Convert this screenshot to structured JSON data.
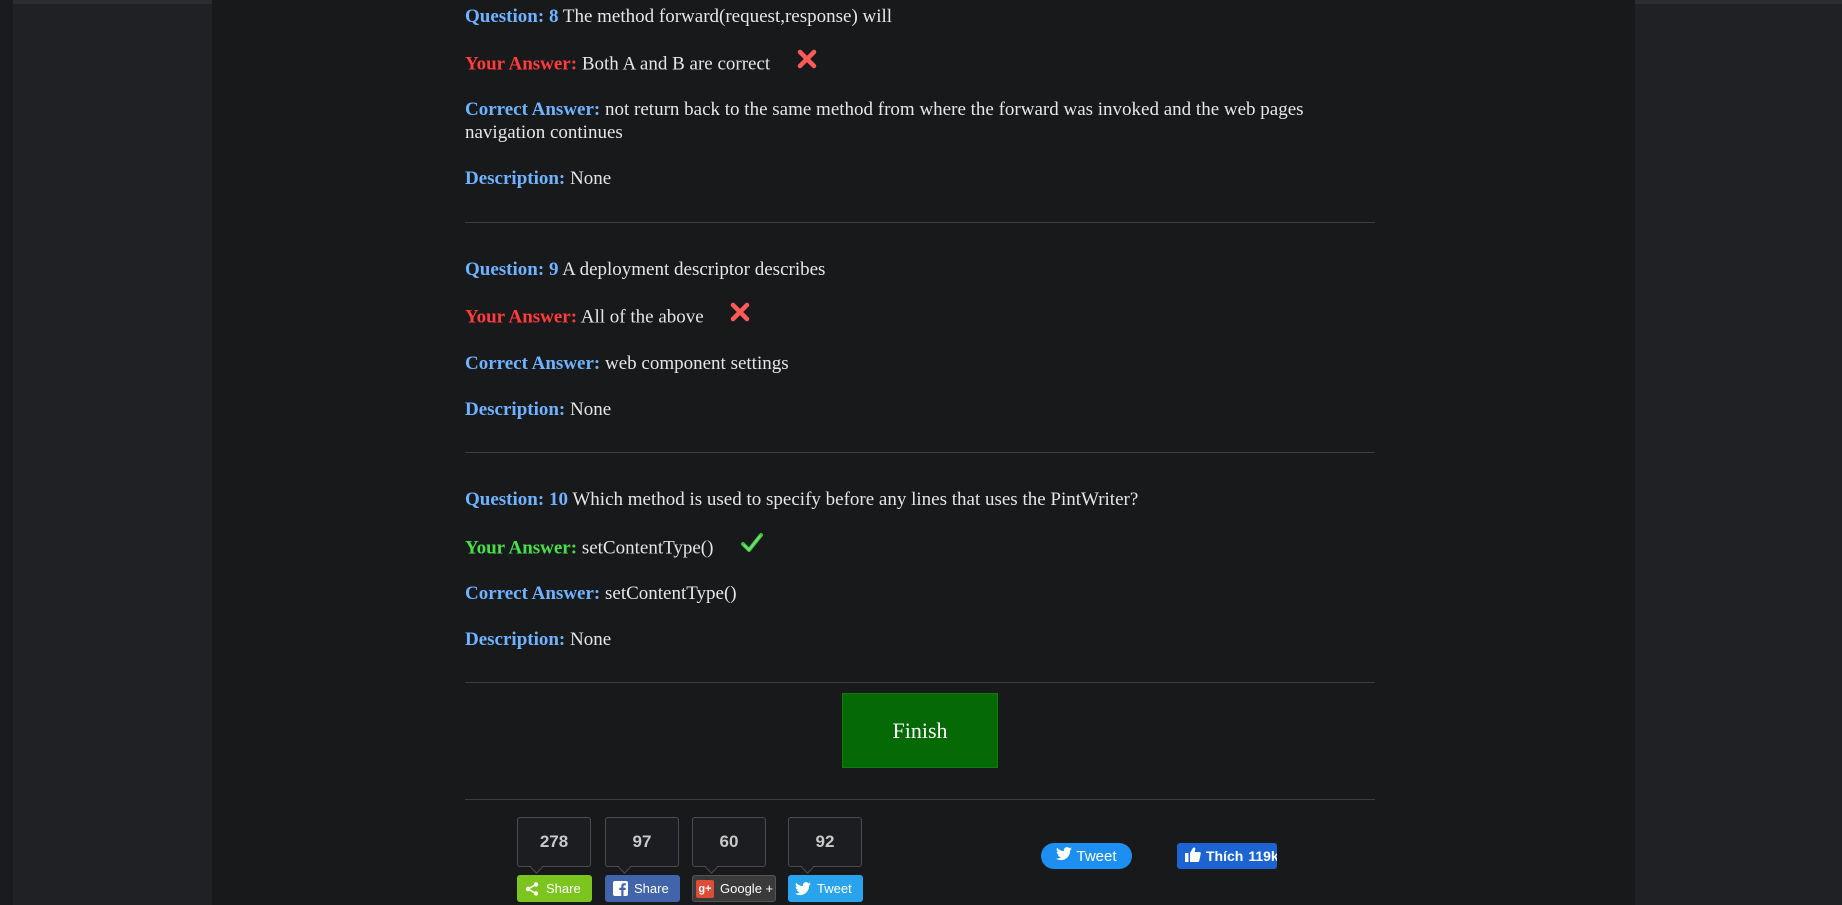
{
  "questions": [
    {
      "label": "Question:",
      "number": "8",
      "text": "The method forward(request,response) will",
      "your_answer_label": "Your Answer:",
      "your_answer": "Both A and B are correct",
      "result": "wrong",
      "correct_answer_label": "Correct Answer:",
      "correct_answer": "not return back to the same method from where the forward was invoked and the web pages navigation continues",
      "description_label": "Description:",
      "description": "None"
    },
    {
      "label": "Question:",
      "number": "9",
      "text": "A deployment descriptor describes",
      "your_answer_label": "Your Answer:",
      "your_answer": "All of the above",
      "result": "wrong",
      "correct_answer_label": "Correct Answer:",
      "correct_answer": "web component settings",
      "description_label": "Description:",
      "description": "None"
    },
    {
      "label": "Question:",
      "number": "10",
      "text": "Which method is used to specify before any lines that uses the PintWriter?",
      "your_answer_label": "Your Answer:",
      "your_answer": "setContentType()",
      "result": "correct",
      "correct_answer_label": "Correct Answer:",
      "correct_answer": "setContentType()",
      "description_label": "Description:",
      "description": "None"
    }
  ],
  "finish_button": {
    "label": "Finish"
  },
  "share": {
    "counts": [
      {
        "value": "278",
        "network": "share"
      },
      {
        "value": "97",
        "network": "facebook"
      },
      {
        "value": "60",
        "network": "google-plus"
      },
      {
        "value": "92",
        "network": "twitter"
      }
    ],
    "buttons": [
      {
        "label": "Share",
        "icon": "share-icon",
        "color": "#7cc51e"
      },
      {
        "label": "Share",
        "icon": "facebook-icon",
        "color": "#4264aa"
      },
      {
        "label": "Google +",
        "icon": "google-plus-icon",
        "color": "#3a3a3a"
      },
      {
        "label": "Tweet",
        "icon": "twitter-icon",
        "color": "#2aa3ef"
      }
    ]
  },
  "social": {
    "tweet_label": "Tweet",
    "like_label": "Thích",
    "like_count": "119k"
  },
  "colors": {
    "question_label": "#6fb2ff",
    "wrong_label": "#ff3b3b",
    "right_label": "#47e046",
    "finish": "#056a05"
  }
}
